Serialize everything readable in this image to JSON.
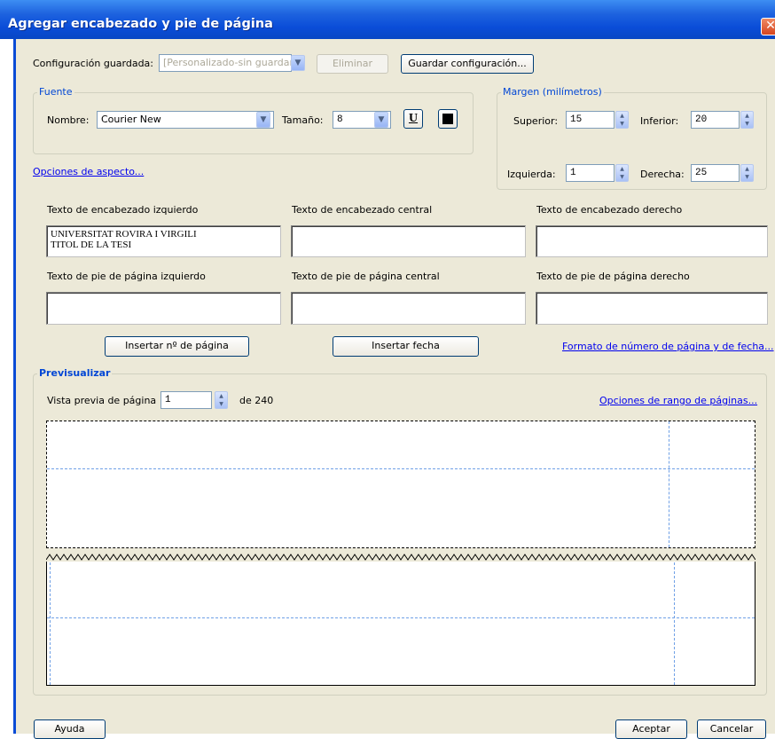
{
  "window": {
    "title": "Agregar encabezado y pie de página"
  },
  "saved_config": {
    "label": "Configuración guardada:",
    "value": "[Personalizado-sin guardar]",
    "delete_label": "Eliminar",
    "save_label": "Guardar configuración..."
  },
  "font": {
    "legend": "Fuente",
    "name_label": "Nombre:",
    "name_value": "Courier New",
    "size_label": "Tamaño:",
    "size_value": "8",
    "underline_label": "U"
  },
  "appearance_link": "Opciones de aspecto...",
  "margins": {
    "legend": "Margen (milímetros)",
    "top_label": "Superior:",
    "top_value": "15",
    "bottom_label": "Inferior:",
    "bottom_value": "20",
    "left_label": "Izquierda:",
    "left_value": "1",
    "right_label": "Derecha:",
    "right_value": "25"
  },
  "header": {
    "left_label": "Texto de encabezado izquierdo",
    "left_value": "UNIVERSITAT ROVIRA I VIRGILI\nTITOL DE LA TESI",
    "center_label": "Texto de encabezado central",
    "center_value": "",
    "right_label": "Texto de encabezado derecho",
    "right_value": ""
  },
  "footer": {
    "left_label": "Texto de pie de página izquierdo",
    "left_value": "",
    "center_label": "Texto de pie de página central",
    "center_value": "",
    "right_label": "Texto de pie de página derecho",
    "right_value": ""
  },
  "insert": {
    "page_number_label": "Insertar nº de página",
    "date_label": "Insertar fecha",
    "format_link": "Formato de número de página y de fecha..."
  },
  "preview": {
    "legend": "Previsualizar",
    "page_label": "Vista previa de página",
    "page_value": "1",
    "of_label": "de 240",
    "range_link": "Opciones de rango de páginas..."
  },
  "buttons": {
    "help": "Ayuda",
    "accept": "Aceptar",
    "cancel": "Cancelar"
  },
  "colors": {
    "title_bar": "#0a4dd8",
    "dialog_bg": "#ece9d8",
    "link": "#0000ee",
    "legend": "#0046d5",
    "guide": "#6fa0e6"
  }
}
